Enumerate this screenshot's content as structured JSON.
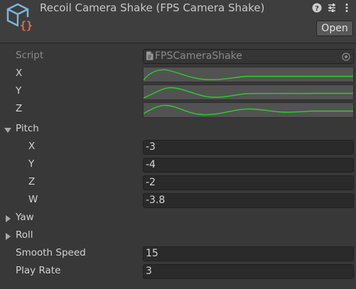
{
  "header": {
    "title": "Recoil Camera Shake (FPS Camera Shake)",
    "open_label": "Open",
    "icons": [
      "help-icon",
      "presets-icon",
      "more-icon"
    ]
  },
  "fields": {
    "script": {
      "label": "Script",
      "value": "FPSCameraShake"
    },
    "curve_x_label": "X",
    "curve_y_label": "Y",
    "curve_z_label": "Z",
    "pitch": {
      "label": "Pitch",
      "expanded": true,
      "x": {
        "label": "X",
        "value": "-3"
      },
      "y": {
        "label": "Y",
        "value": "-4"
      },
      "z": {
        "label": "Z",
        "value": "-2"
      },
      "w": {
        "label": "W",
        "value": "-3.8"
      }
    },
    "yaw": {
      "label": "Yaw",
      "expanded": false
    },
    "roll": {
      "label": "Roll",
      "expanded": false
    },
    "smooth_speed": {
      "label": "Smooth Speed",
      "value": "15"
    },
    "play_rate": {
      "label": "Play Rate",
      "value": "3"
    }
  },
  "colors": {
    "curve": "#28d228",
    "background": "#383838",
    "field": "#2a2a2a"
  }
}
